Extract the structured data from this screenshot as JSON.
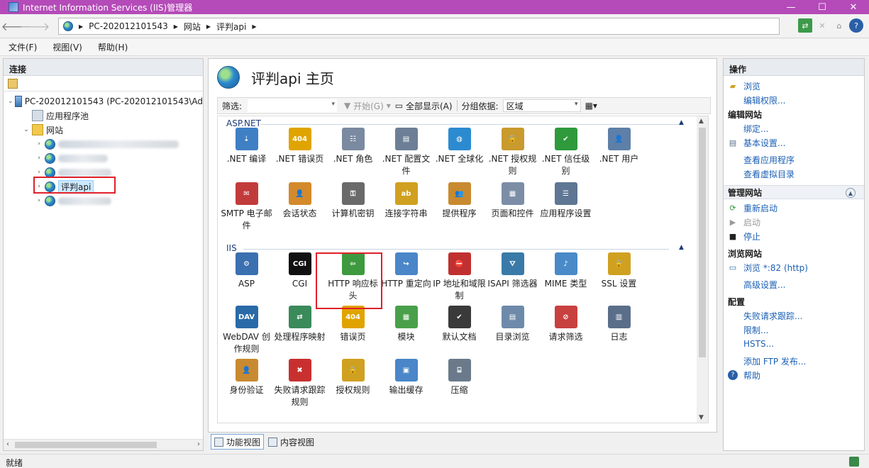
{
  "window": {
    "title": "Internet Information Services (IIS)管理器",
    "controls": [
      "—",
      "☐",
      "✕"
    ]
  },
  "address": {
    "crumbs": [
      "PC-202012101543",
      "网站",
      "评判api"
    ]
  },
  "menu": [
    "文件(F)",
    "视图(V)",
    "帮助(H)"
  ],
  "connections": {
    "title": "连接",
    "tree": {
      "server": "PC-202012101543 (PC-202012101543\\Ad",
      "app_pools": "应用程序池",
      "sites": "网站",
      "selected_site": "评判api"
    }
  },
  "main": {
    "title": "评判api 主页",
    "filter_label": "筛选:",
    "go_label": "开始(G)",
    "show_all_label": "全部显示(A)",
    "group_by_label": "分组依据:",
    "group_by_value": "区域",
    "groups": [
      {
        "name": "ASP.NET",
        "rows": [
          [
            {
              "label": ".NET 编译",
              "icon": "net-compilation-icon",
              "color": "#3f7fc4",
              "glyph": "⇣"
            },
            {
              "label": ".NET 错误页",
              "icon": "net-error-pages-icon",
              "color": "#e0a400",
              "glyph": "404"
            },
            {
              "label": ".NET 角色",
              "icon": "net-roles-icon",
              "color": "#7a8aa0",
              "glyph": "☷"
            },
            {
              "label": ".NET 配置文件",
              "icon": "net-profile-icon",
              "color": "#6d7f96",
              "glyph": "▤"
            },
            {
              "label": ".NET 全球化",
              "icon": "net-globalization-icon",
              "color": "#2c8bd0",
              "glyph": "◍"
            },
            {
              "label": ".NET 授权规则",
              "icon": "net-authorization-icon",
              "color": "#c99a2e",
              "glyph": "🔒"
            },
            {
              "label": ".NET 信任级别",
              "icon": "net-trust-levels-icon",
              "color": "#2e9a3c",
              "glyph": "✔"
            },
            {
              "label": ".NET 用户",
              "icon": "net-users-icon",
              "color": "#5d7fa8",
              "glyph": "👤"
            }
          ],
          [
            {
              "label": "SMTP 电子邮件",
              "icon": "smtp-email-icon",
              "color": "#c23b3b",
              "glyph": "✉"
            },
            {
              "label": "会话状态",
              "icon": "session-state-icon",
              "color": "#d48a2a",
              "glyph": "👤"
            },
            {
              "label": "计算机密钥",
              "icon": "machine-key-icon",
              "color": "#6a6a6a",
              "glyph": "⚿"
            },
            {
              "label": "连接字符串",
              "icon": "connection-strings-icon",
              "color": "#d0a020",
              "glyph": "ab"
            },
            {
              "label": "提供程序",
              "icon": "providers-icon",
              "color": "#c88a30",
              "glyph": "👥"
            },
            {
              "label": "页面和控件",
              "icon": "pages-controls-icon",
              "color": "#7c8ea6",
              "glyph": "▦"
            },
            {
              "label": "应用程序设置",
              "icon": "app-settings-icon",
              "color": "#5f7694",
              "glyph": "☰"
            }
          ]
        ]
      },
      {
        "name": "IIS",
        "rows": [
          [
            {
              "label": "ASP",
              "icon": "asp-icon",
              "color": "#3a6fb0",
              "glyph": "⚙"
            },
            {
              "label": "CGI",
              "icon": "cgi-icon",
              "color": "#111111",
              "glyph": "CGI"
            },
            {
              "label": "HTTP 响应标头",
              "icon": "http-response-headers-icon",
              "color": "#3e9a3e",
              "glyph": "⇦"
            },
            {
              "label": "HTTP 重定向",
              "icon": "http-redirect-icon",
              "color": "#4a86c8",
              "glyph": "↪"
            },
            {
              "label": "IP 地址和域限制",
              "icon": "ip-restrictions-icon",
              "color": "#c03030",
              "glyph": "⛔"
            },
            {
              "label": "ISAPI 筛选器",
              "icon": "isapi-filters-icon",
              "color": "#3a7aa8",
              "glyph": "⛛"
            },
            {
              "label": "MIME 类型",
              "icon": "mime-types-icon",
              "color": "#4a8ac8",
              "glyph": "♪"
            },
            {
              "label": "SSL 设置",
              "icon": "ssl-settings-icon",
              "color": "#d0a020",
              "glyph": "🔒"
            }
          ],
          [
            {
              "label": "WebDAV 创作规则",
              "icon": "webdav-icon",
              "color": "#2a6aa8",
              "glyph": "DAV"
            },
            {
              "label": "处理程序映射",
              "icon": "handler-mappings-icon",
              "color": "#3a8a5a",
              "glyph": "⇄"
            },
            {
              "label": "错误页",
              "icon": "error-pages-icon",
              "color": "#e0a400",
              "glyph": "404"
            },
            {
              "label": "模块",
              "icon": "modules-icon",
              "color": "#4aa04a",
              "glyph": "▦"
            },
            {
              "label": "默认文档",
              "icon": "default-document-icon",
              "color": "#3a3a3a",
              "glyph": "✔"
            },
            {
              "label": "目录浏览",
              "icon": "directory-browsing-icon",
              "color": "#6e8aaa",
              "glyph": "▤"
            },
            {
              "label": "请求筛选",
              "icon": "request-filtering-icon",
              "color": "#c84040",
              "glyph": "⊘"
            },
            {
              "label": "日志",
              "icon": "logging-icon",
              "color": "#5a6e8a",
              "glyph": "▥"
            }
          ],
          [
            {
              "label": "身份验证",
              "icon": "authentication-icon",
              "color": "#c88a30",
              "glyph": "👤"
            },
            {
              "label": "失败请求跟踪规则",
              "icon": "failed-request-tracing-icon",
              "color": "#c83030",
              "glyph": "✖"
            },
            {
              "label": "授权规则",
              "icon": "authorization-rules-icon",
              "color": "#d0a020",
              "glyph": "🔒"
            },
            {
              "label": "输出缓存",
              "icon": "output-caching-icon",
              "color": "#4a86c8",
              "glyph": "▣"
            },
            {
              "label": "压缩",
              "icon": "compression-icon",
              "color": "#6a7a8a",
              "glyph": "⌸"
            }
          ]
        ]
      }
    ],
    "view_tabs": [
      "功能视图",
      "内容视图"
    ]
  },
  "actions": {
    "title": "操作",
    "items_top": [
      "浏览",
      "编辑权限..."
    ],
    "edit_site_title": "编辑网站",
    "edit_site": [
      "绑定...",
      "基本设置...",
      "查看应用程序",
      "查看虚拟目录"
    ],
    "manage_site_title": "管理网站",
    "manage": [
      "重新启动",
      "启动",
      "停止"
    ],
    "browse_title": "浏览网站",
    "browse": [
      "浏览 *:82 (http)"
    ],
    "advanced": "高级设置...",
    "config_title": "配置",
    "config": [
      "失败请求跟踪...",
      "限制...",
      "HSTS..."
    ],
    "ftp": "添加 FTP 发布...",
    "help": "帮助"
  },
  "status": {
    "text": "就绪"
  }
}
